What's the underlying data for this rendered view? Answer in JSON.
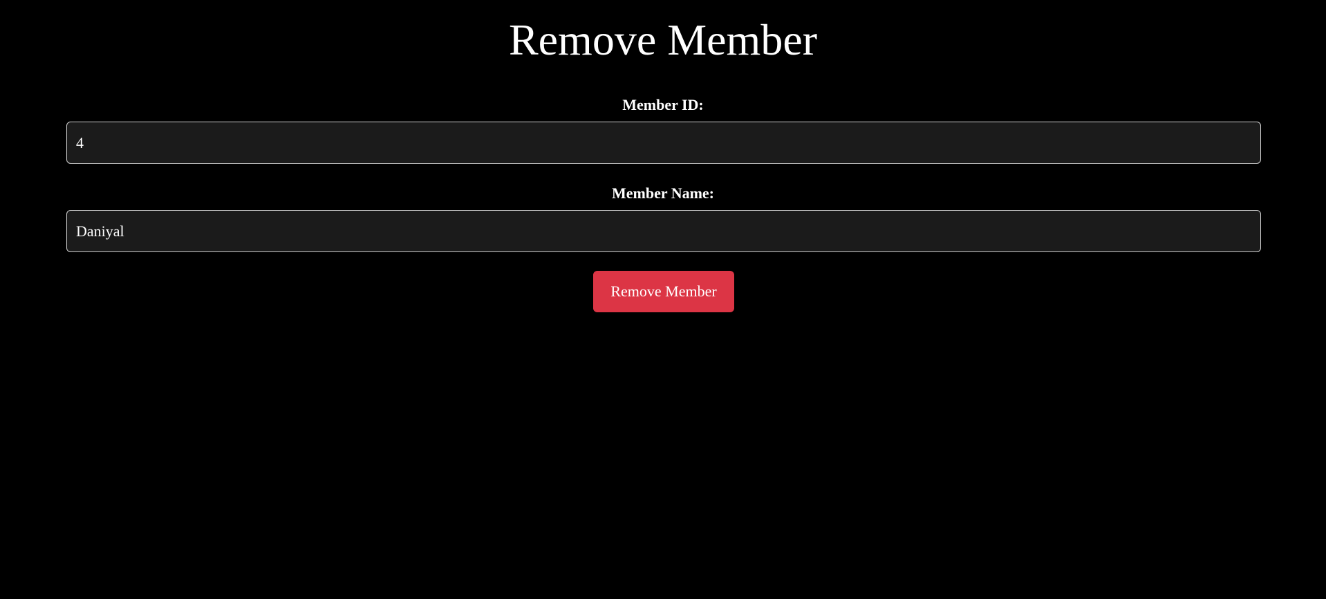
{
  "page": {
    "title": "Remove Member"
  },
  "form": {
    "member_id": {
      "label": "Member ID:",
      "value": "4"
    },
    "member_name": {
      "label": "Member Name:",
      "value": "Daniyal"
    },
    "submit_label": "Remove Member"
  },
  "colors": {
    "background": "#000000",
    "input_background": "#1b1b1b",
    "danger_button": "#dc3545",
    "text": "#ffffff"
  }
}
